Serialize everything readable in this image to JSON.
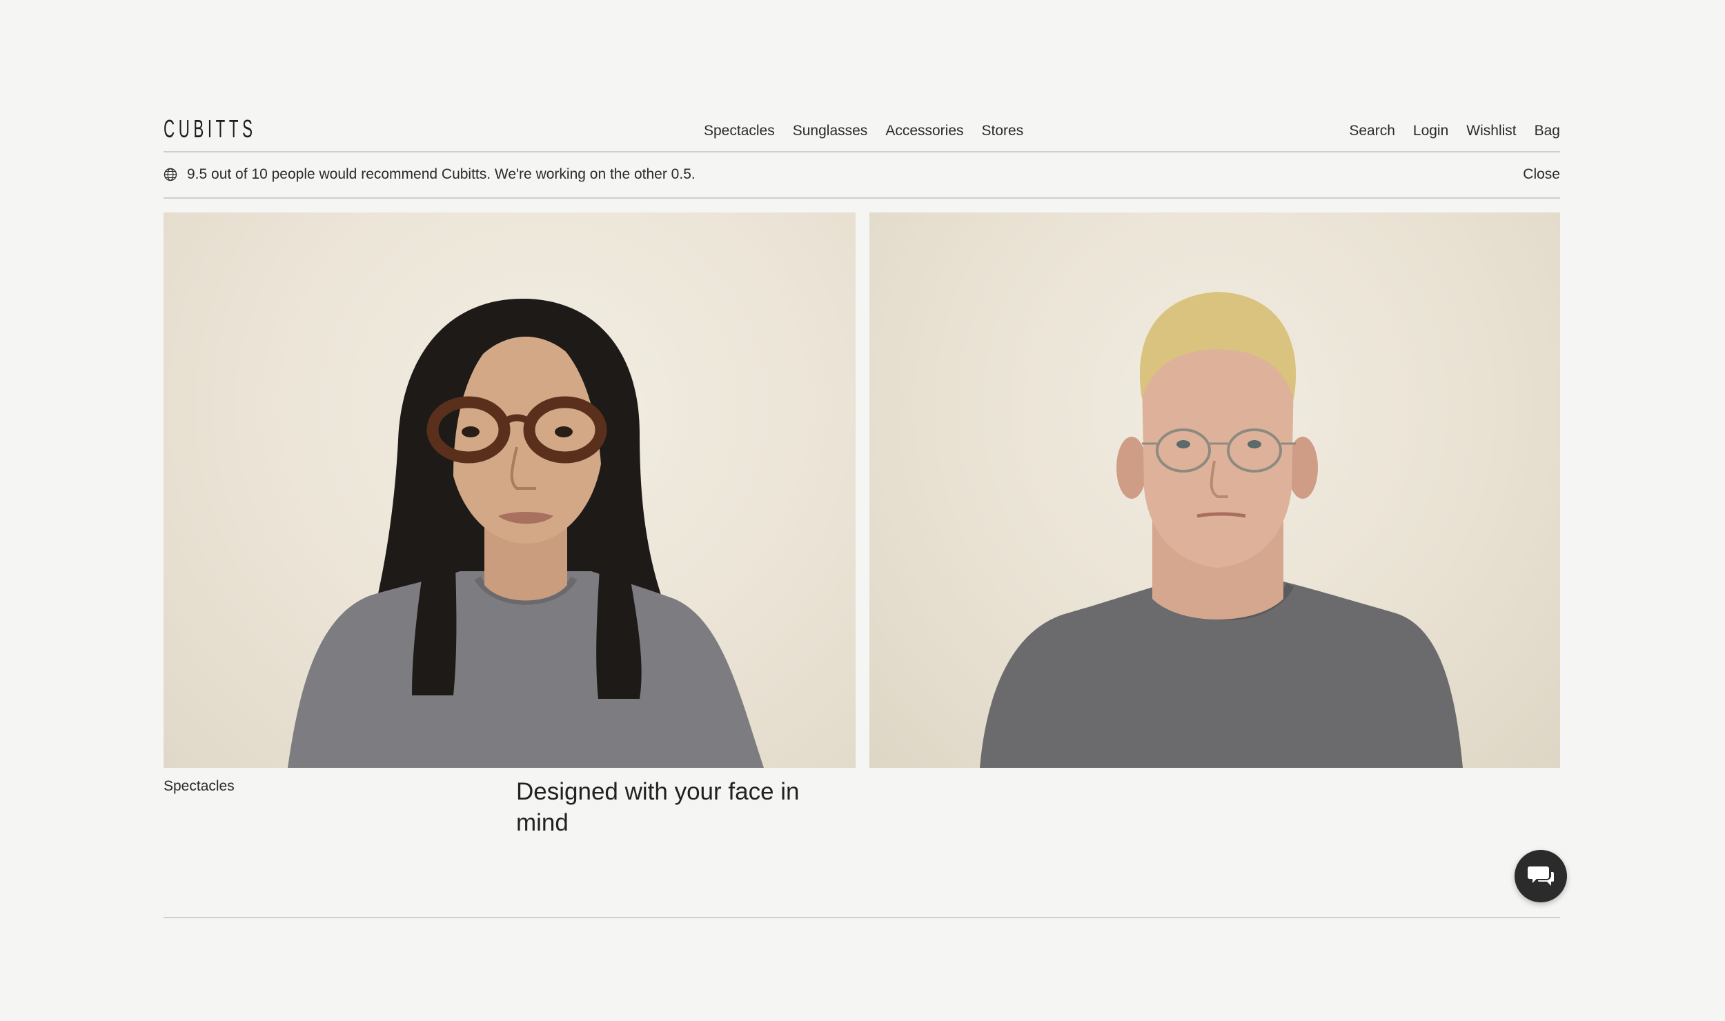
{
  "brand": {
    "logo_text": "CUBITTS"
  },
  "nav": {
    "primary": [
      {
        "label": "Spectacles"
      },
      {
        "label": "Sunglasses"
      },
      {
        "label": "Accessories"
      },
      {
        "label": "Stores"
      }
    ],
    "utility": [
      {
        "label": "Search"
      },
      {
        "label": "Login"
      },
      {
        "label": "Wishlist"
      },
      {
        "label": "Bag"
      }
    ]
  },
  "announcement": {
    "icon": "globe-icon",
    "text": "9.5 out of 10 people would recommend Cubitts. We're working on the other 0.5.",
    "close_label": "Close"
  },
  "hero": {
    "left_image": "woman-tortoiseshell-spectacles",
    "right_image": "man-wire-frame-spectacles",
    "category_label": "Spectacles",
    "headline": "Designed with your face in mind"
  },
  "chat": {
    "icon": "chat-bubbles-icon"
  },
  "colors": {
    "background": "#f5f5f3",
    "text": "#2a2a2a",
    "rule": "#cfcfcc",
    "chat_button": "#2b2b2b"
  }
}
